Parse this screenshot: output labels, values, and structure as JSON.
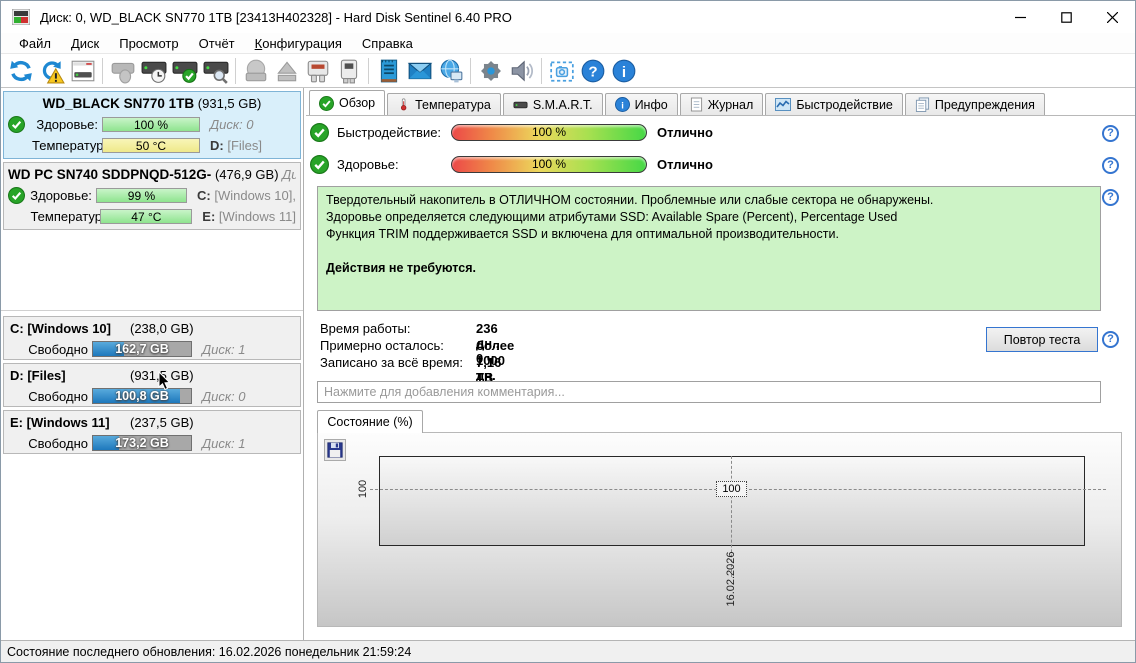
{
  "window": {
    "title": "Диск: 0, WD_BLACK SN770 1TB [23413H402328]  -  Hard Disk Sentinel 6.40 PRO",
    "controls": [
      "minimize",
      "maximize",
      "close"
    ]
  },
  "menu": {
    "items": [
      "Файл",
      "Диск",
      "Просмотр",
      "Отчёт",
      "Конфигурация",
      "Справка"
    ]
  },
  "toolbar": {
    "icons": [
      "refresh",
      "refresh-test",
      "disk-overview",
      "detect-disks",
      "disk-tests",
      "accept-disk",
      "analyse-disk",
      "offline-disk",
      "eject-disk",
      "disk-connection",
      "disk-power",
      "report",
      "send-email",
      "network",
      "settings",
      "sounds",
      "screenshot",
      "help",
      "about"
    ]
  },
  "sidebar": {
    "disks": [
      {
        "name": "WD_BLACK SN770 1TB",
        "size": "(931,5 GB)",
        "health_label": "Здоровье:",
        "health_value": "100 %",
        "right1": "Диск: 0",
        "temp_label": "Температура:",
        "temp_value": "50 °C",
        "right2_drive": "D:",
        "right2_label": "[Files]"
      },
      {
        "name": "WD PC SN740 SDDPNQD-512G-",
        "size": "(476,9 GB)",
        "disk_tag": "Диск:",
        "health_label": "Здоровье:",
        "health_value": "99 %",
        "right1_drive": "C:",
        "right1_label": "[Windows 10],",
        "temp_label": "Температура:",
        "temp_value": "47 °C",
        "right2_drive": "E:",
        "right2_label": "[Windows 11]"
      }
    ],
    "partitions": [
      {
        "name": "C: [Windows 10]",
        "size": "(238,0 GB)",
        "free_label": "Свободно",
        "free_value": "162,7 GB",
        "disk_tag": "Диск: 1",
        "used_pct": 32
      },
      {
        "name": "D: [Files]",
        "size": "(931,5 GB)",
        "free_label": "Свободно",
        "free_value": "100,8 GB",
        "disk_tag": "Диск: 0",
        "used_pct": 89
      },
      {
        "name": "E: [Windows 11]",
        "size": "(237,5 GB)",
        "free_label": "Свободно",
        "free_value": "173,2 GB",
        "disk_tag": "Диск: 1",
        "used_pct": 27
      }
    ]
  },
  "tabs": [
    {
      "label": "Обзор",
      "icon": "check-circle",
      "active": true
    },
    {
      "label": "Температура",
      "icon": "thermometer"
    },
    {
      "label": "S.M.A.R.T.",
      "icon": "disk"
    },
    {
      "label": "Инфо",
      "icon": "info-circle"
    },
    {
      "label": "Журнал",
      "icon": "document"
    },
    {
      "label": "Быстродействие",
      "icon": "chart"
    },
    {
      "label": "Предупреждения",
      "icon": "pages"
    }
  ],
  "overview": {
    "performance_label": "Быстродействие:",
    "performance_value": "100 %",
    "performance_status": "Отлично",
    "health_label": "Здоровье:",
    "health_value": "100 %",
    "health_status": "Отлично",
    "description_line1": "Твердотельный накопитель в ОТЛИЧНОМ состоянии. Проблемные или слабые сектора не обнаружены.",
    "description_line2": "Здоровье определяется следующими атрибутами SSD: Available Spare (Percent), Percentage Used",
    "description_line3": "Функция TRIM поддерживается SSD и включена для оптимальной производительности.",
    "action_line": "Действия не требуются.",
    "stats": [
      {
        "label": "Время работы:",
        "value": "236 дн., 0 ч"
      },
      {
        "label": "Примерно осталось:",
        "value": "более 1000 дн."
      },
      {
        "label": "Записано за всё время:",
        "value": "7,16 TB"
      }
    ],
    "retest_button": "Повтор теста",
    "comment_placeholder": "Нажмите для добавления комментария..."
  },
  "chart_data": {
    "type": "line",
    "title": "Состояние (%)",
    "x": [
      "16.02.2026"
    ],
    "series": [
      {
        "name": "Состояние (%)",
        "values": [
          100
        ]
      }
    ],
    "yticks": [
      "100"
    ],
    "point_label": "100",
    "xlabel": "",
    "ylabel": "",
    "grid": "dashed crosshair at data point",
    "legend": "none"
  },
  "statusbar": {
    "text": "Состояние последнего обновления: 16.02.2026 понедельник 21:59:24"
  }
}
